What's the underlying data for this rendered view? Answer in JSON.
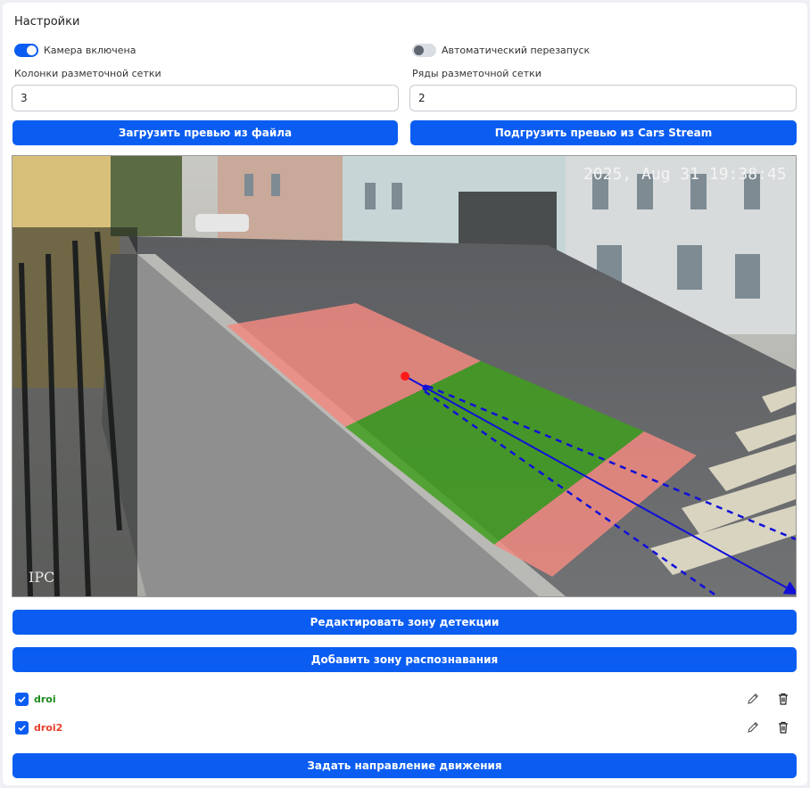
{
  "settings": {
    "title": "Настройки",
    "camera_toggle": {
      "label": "Камера включена",
      "on": true
    },
    "auto_restart_toggle": {
      "label": "Автоматический перезапуск",
      "on": false
    },
    "columns": {
      "label": "Колонки разметочной сетки",
      "value": "3"
    },
    "rows": {
      "label": "Ряды разметочной сетки",
      "value": "2"
    }
  },
  "buttons": {
    "upload_file": "Загрузить превью из файла",
    "load_cars_stream": "Подгрузить превью из Cars Stream",
    "edit_zone": "Редактировать зону детекции",
    "add_zone": "Добавить зону распознавания",
    "set_direction": "Задать направление движения"
  },
  "preview": {
    "timestamp": "2025, Aug 31 19:38:45",
    "watermark": "IPC"
  },
  "zones": [
    {
      "name": "droi",
      "checked": true,
      "color": "#1e8a1e"
    },
    {
      "name": "droi2",
      "checked": true,
      "color": "#e8402a"
    }
  ],
  "colors": {
    "accent": "#0b5cf0",
    "zone_red": "#f08a80",
    "zone_green": "#3f9d1f",
    "direction": "#1010d8"
  },
  "icons": {
    "edit": "pencil-icon",
    "delete": "trash-icon",
    "check": "checkmark-icon"
  }
}
